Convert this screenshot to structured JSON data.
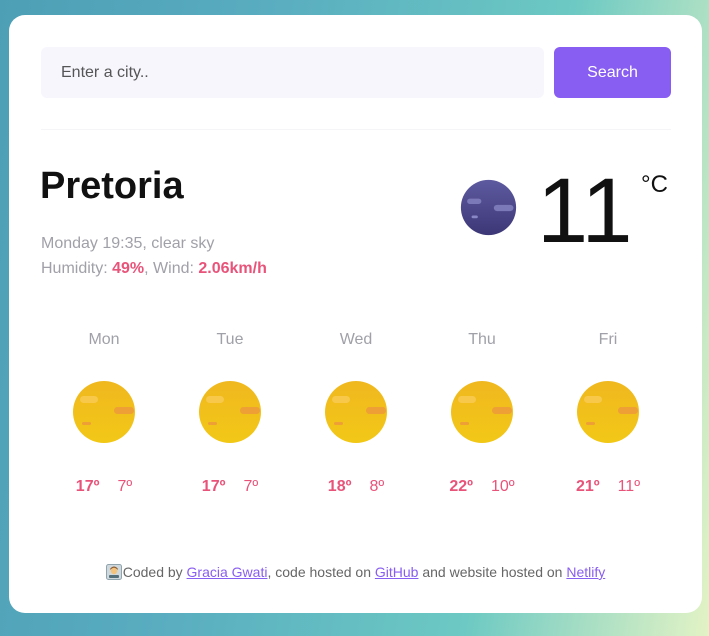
{
  "search": {
    "placeholder": "Enter a city..",
    "button_label": "Search"
  },
  "current": {
    "city": "Pretoria",
    "datetime_desc": "Monday 19:35, clear sky",
    "humidity_label": "Humidity: ",
    "humidity_value": "49%",
    "wind_label": ", Wind: ",
    "wind_value": "2.06km/h",
    "temperature": "11",
    "unit": "°C",
    "icon": "clear-night-icon"
  },
  "forecast": [
    {
      "day": "Mon",
      "max": "17º",
      "min": "7º",
      "icon": "sunny-icon"
    },
    {
      "day": "Tue",
      "max": "17º",
      "min": "7º",
      "icon": "sunny-icon"
    },
    {
      "day": "Wed",
      "max": "18º",
      "min": "8º",
      "icon": "sunny-icon"
    },
    {
      "day": "Thu",
      "max": "22º",
      "min": "10º",
      "icon": "sunny-icon"
    },
    {
      "day": "Fri",
      "max": "21º",
      "min": "11º",
      "icon": "sunny-icon"
    }
  ],
  "footer": {
    "prefix": "Coded by ",
    "author_link": "Gracia Gwati",
    "middle": ", code hosted on ",
    "github_link": "GitHub",
    "middle2": " and website hosted on ",
    "netlify_link": "Netlify",
    "icon": "woman-technologist-icon"
  },
  "colors": {
    "accent": "#885df1",
    "highlight": "#e8537a",
    "muted": "#a0a0a8"
  }
}
